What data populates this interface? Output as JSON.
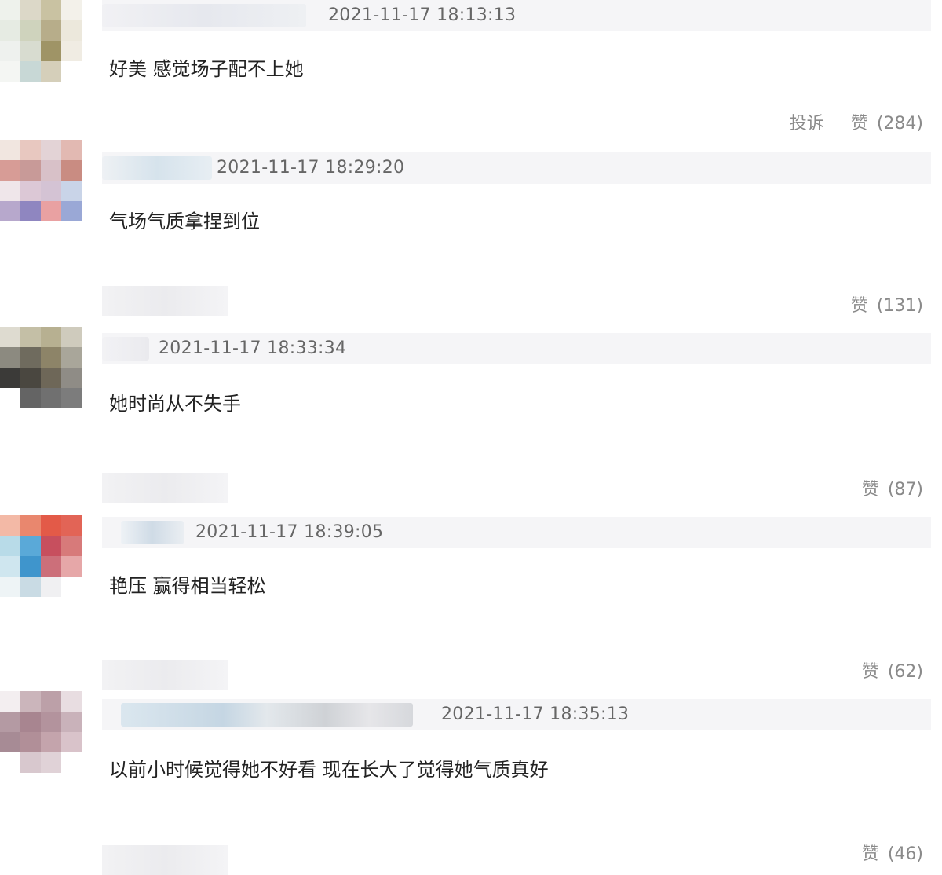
{
  "comments": [
    {
      "timestamp": "2021-11-17 18:13:13",
      "text": "好美 感觉场子配不上她",
      "report_label": "投诉",
      "like_label": "赞",
      "like_count": "(284)"
    },
    {
      "timestamp": "2021-11-17 18:29:20",
      "text": "气场气质拿捏到位",
      "like_label": "赞",
      "like_count": "(131)"
    },
    {
      "timestamp": "2021-11-17 18:33:34",
      "text": "她时尚从不失手",
      "like_label": "赞",
      "like_count": "(87)"
    },
    {
      "timestamp": "2021-11-17 18:39:05",
      "text": "艳压 赢得相当轻松",
      "like_label": "赞",
      "like_count": "(62)"
    },
    {
      "timestamp": "2021-11-17 18:35:13",
      "text": "以前小时候觉得她不好看 现在长大了觉得她气质真好",
      "like_label": "赞",
      "like_count": "(46)"
    }
  ],
  "colors": {
    "header_bg": "#f5f5f7",
    "timestamp": "#666666",
    "text": "#222222",
    "actions": "#8a8a8a"
  }
}
